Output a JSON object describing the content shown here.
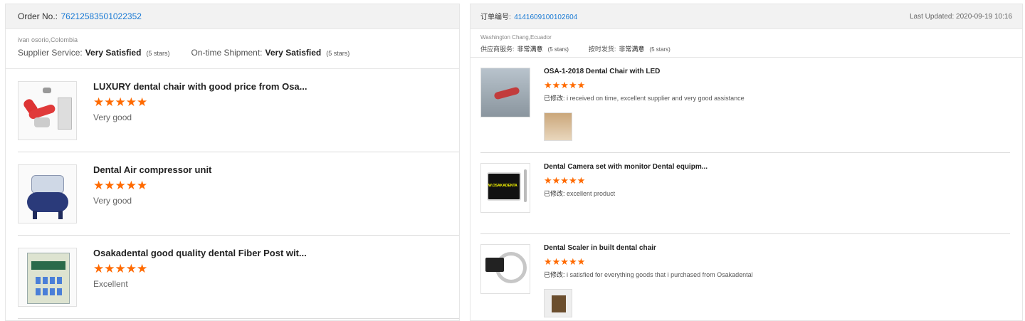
{
  "left": {
    "order_label": "Order No.:",
    "order_no": "76212583501022352",
    "buyer": "ivan osorio,Colombia",
    "supplier_service_label": "Supplier Service:",
    "supplier_service_value": "Very Satisfied",
    "supplier_service_stars": "(5 stars)",
    "shipment_label": "On-time Shipment:",
    "shipment_value": "Very Satisfied",
    "shipment_stars": "(5 stars)",
    "reviews": [
      {
        "title": "LUXURY dental chair with good price from Osa...",
        "stars": "★★★★★",
        "rating": 5,
        "comment": "Very good",
        "thumb_icon": "dental-chair"
      },
      {
        "title": "Dental Air compressor unit",
        "stars": "★★★★★",
        "rating": 5,
        "comment": "Very good",
        "thumb_icon": "air-compressor"
      },
      {
        "title": "Osakadental good quality dental Fiber Post wit...",
        "stars": "★★★★★",
        "rating": 5,
        "comment": "Excellent",
        "thumb_icon": "fiber-post-box"
      }
    ]
  },
  "right": {
    "order_label": "订单编号:",
    "order_no": "4141609100102604",
    "last_updated": "Last Updated: 2020-09-19 10:16",
    "buyer": "Washington Chang,Ecuador",
    "supplier_service_label": "供应商服务:",
    "supplier_service_value": "非常满意",
    "supplier_service_stars": "(5 stars)",
    "shipment_label": "按时发货:",
    "shipment_value": "非常满意",
    "shipment_stars": "(5 stars)",
    "review_prefix": "已修改:",
    "reviews": [
      {
        "title": "OSA-1-2018 Dental Chair with LED",
        "stars": "★★★★★",
        "rating": 5,
        "comment": "i received on time, excellent supplier and very good assistance",
        "thumb_icon": "dental-chair-led",
        "has_photo": true
      },
      {
        "title": "Dental Camera set with monitor Dental equipm...",
        "stars": "★★★★★",
        "rating": 5,
        "comment": "excellent product",
        "thumb_icon": "dental-camera",
        "camera_brand": "W.OSAKADENTA",
        "has_photo": false
      },
      {
        "title": "Dental Scaler in built dental chair",
        "stars": "★★★★★",
        "rating": 5,
        "comment": "i satisfied for everything goods that i purchased from Osakadental",
        "thumb_icon": "dental-scaler",
        "has_photo": true
      }
    ]
  },
  "colors": {
    "star": "#ff6a00",
    "link": "#1a7ad4",
    "header_bg": "#f2f2f2"
  }
}
